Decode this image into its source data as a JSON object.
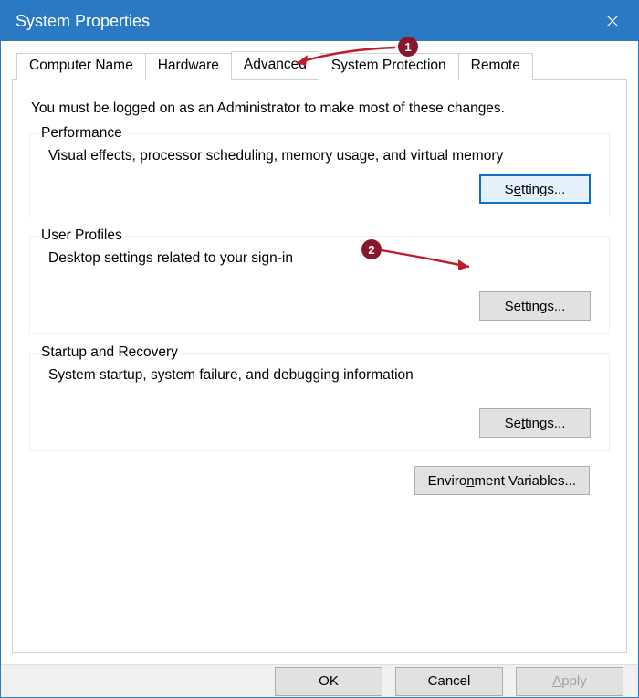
{
  "titlebar": {
    "title": "System Properties"
  },
  "tabs": {
    "computer_name": "Computer Name",
    "hardware": "Hardware",
    "advanced": "Advanced",
    "system_protection": "System Protection",
    "remote": "Remote"
  },
  "intro": "You must be logged on as an Administrator to make most of these changes.",
  "sections": {
    "performance": {
      "title": "Performance",
      "desc": "Visual effects, processor scheduling, memory usage, and virtual memory",
      "button_prefix": "S",
      "button_accel": "e",
      "button_suffix": "ttings..."
    },
    "user_profiles": {
      "title": "User Profiles",
      "desc": "Desktop settings related to your sign-in",
      "button_prefix": "S",
      "button_accel": "e",
      "button_suffix": "ttings..."
    },
    "startup_recovery": {
      "title": "Startup and Recovery",
      "desc": "System startup, system failure, and debugging information",
      "button_prefix": "Se",
      "button_accel": "t",
      "button_suffix": "tings..."
    }
  },
  "env_button": {
    "prefix": "Enviro",
    "accel": "n",
    "suffix": "ment Variables..."
  },
  "footer": {
    "ok": "OK",
    "cancel": "Cancel",
    "apply_prefix": "",
    "apply_accel": "A",
    "apply_suffix": "pply"
  },
  "annotations": {
    "badge1": "1",
    "badge2": "2"
  }
}
